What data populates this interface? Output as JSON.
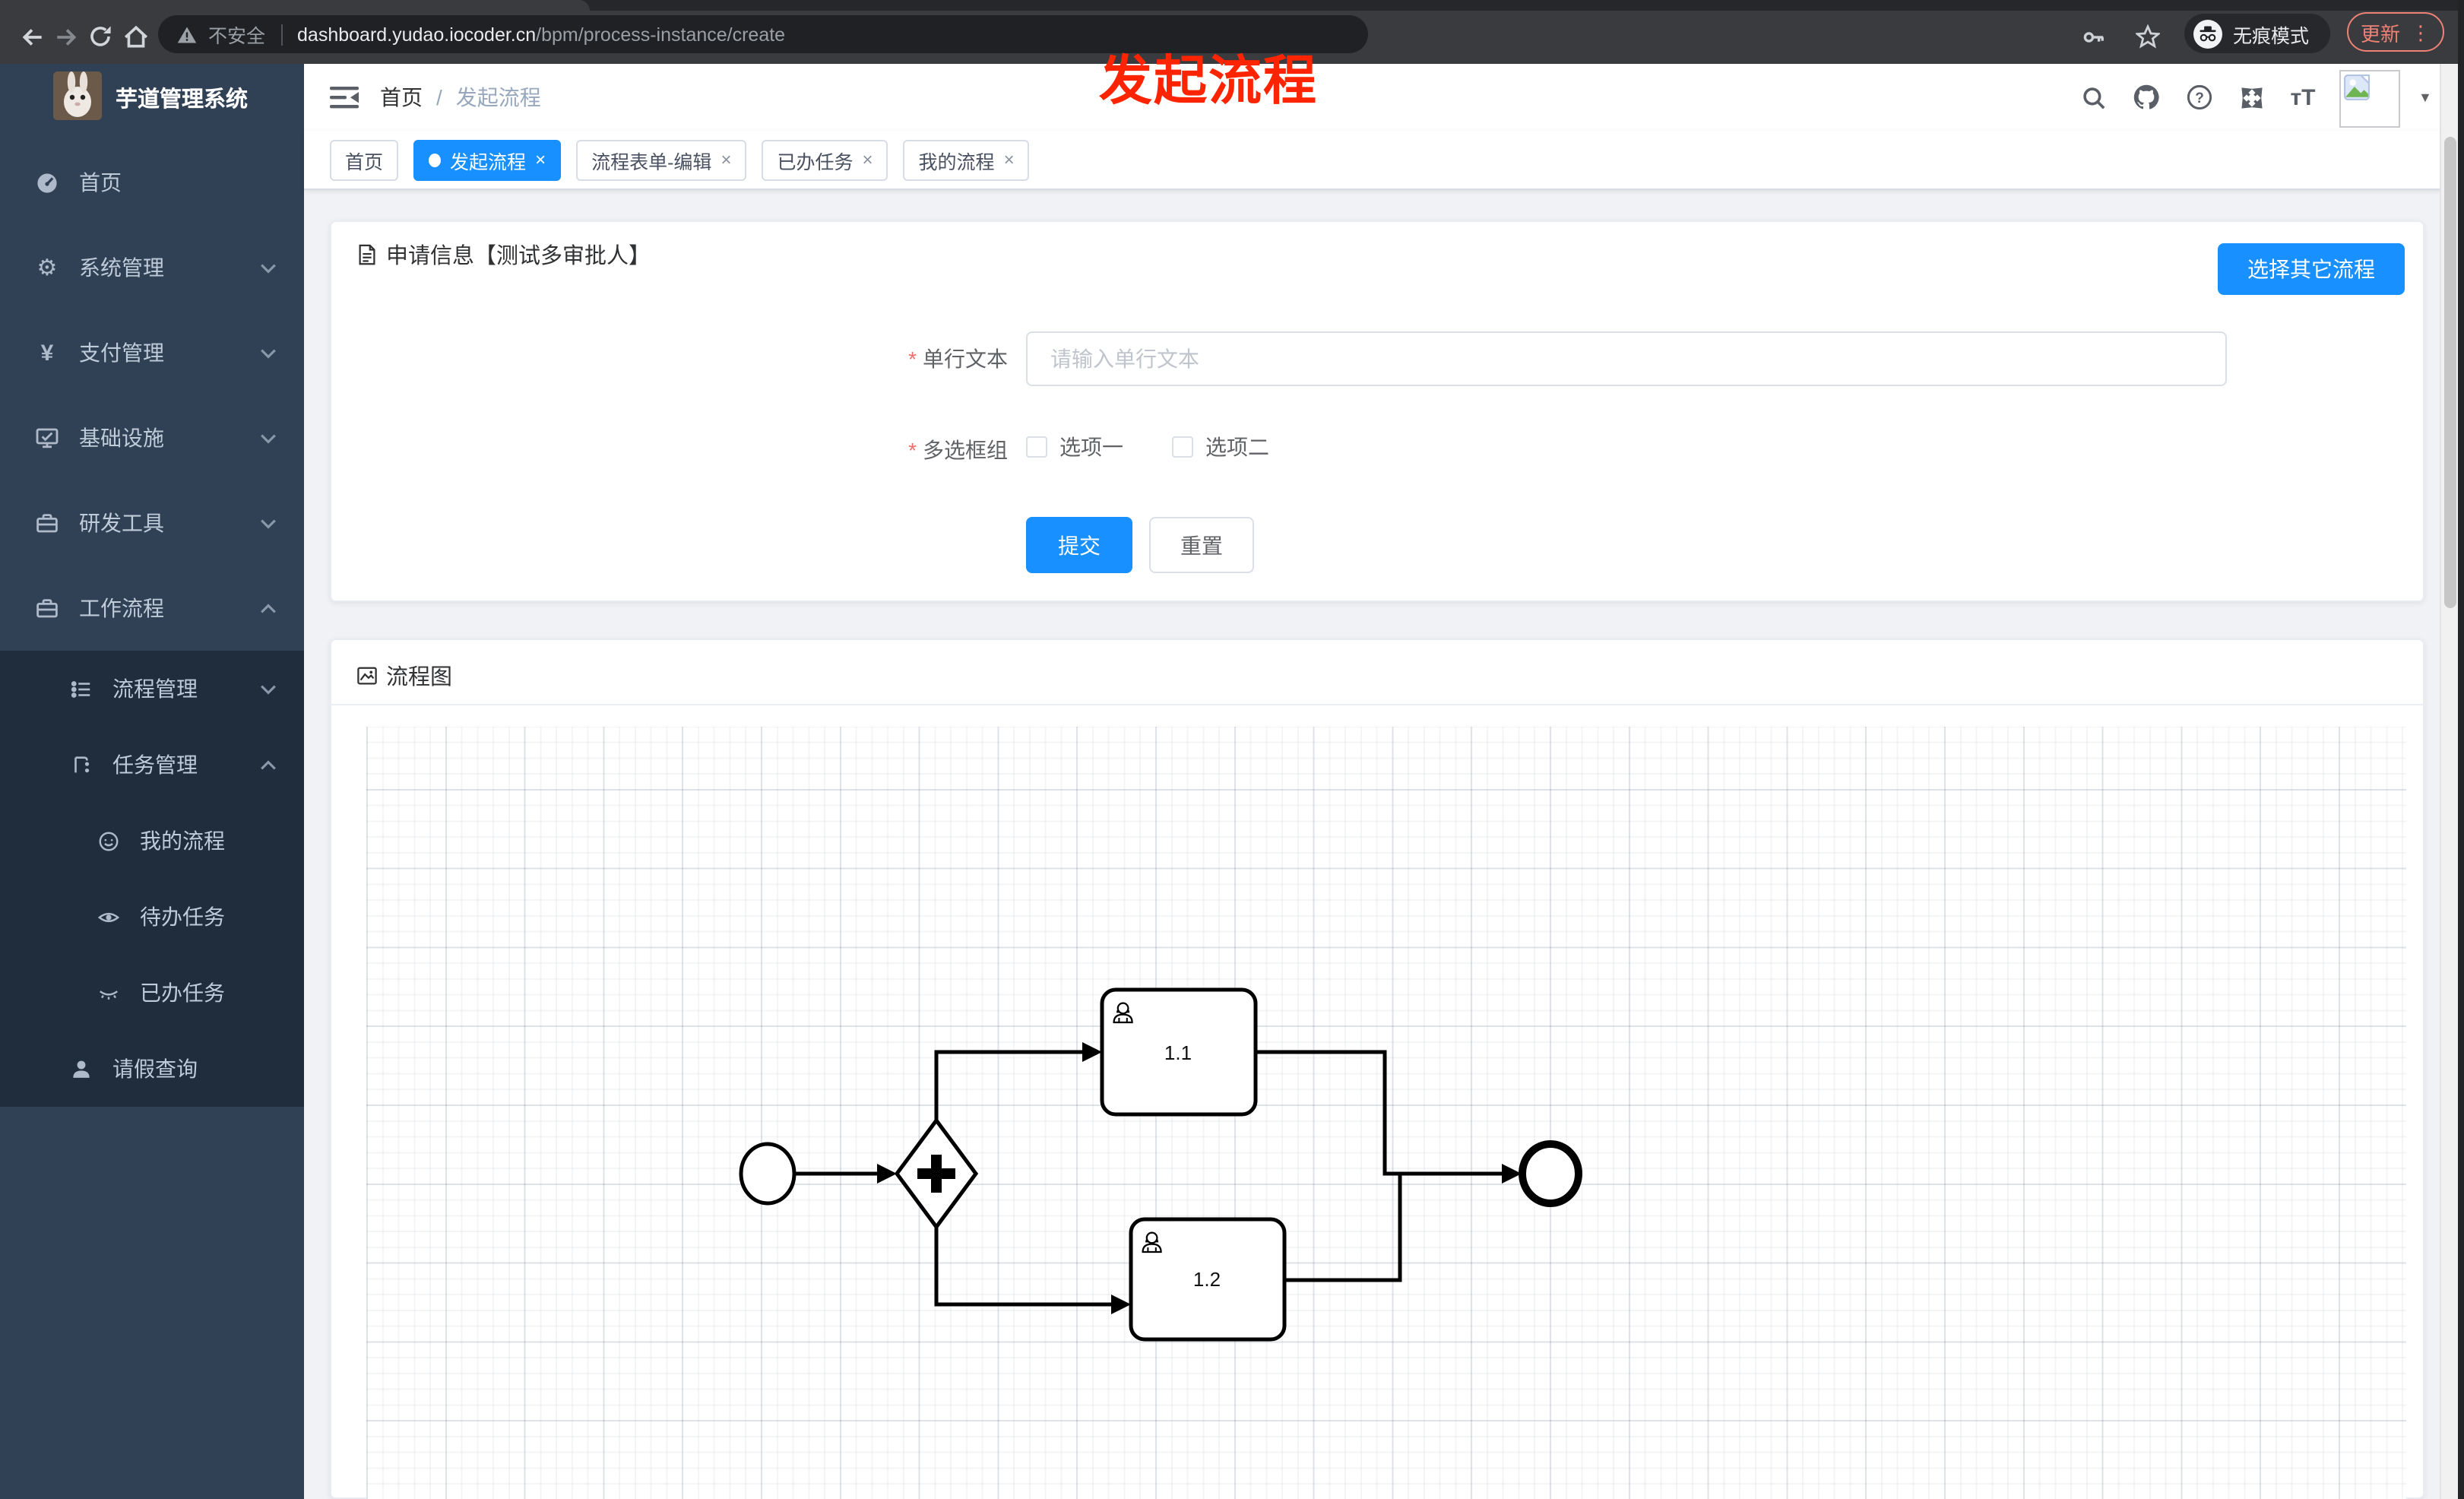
{
  "browser": {
    "security_label": "不安全",
    "url_domain": "dashboard.yudao.iocoder.cn",
    "url_path": "/bpm/process-instance/create",
    "incognito_label": "无痕模式",
    "update_label": "更新"
  },
  "overlay": {
    "title": "发起流程"
  },
  "sidebar": {
    "app_title": "芋道管理系统",
    "items": [
      {
        "label": "首页"
      },
      {
        "label": "系统管理"
      },
      {
        "label": "支付管理"
      },
      {
        "label": "基础设施"
      },
      {
        "label": "研发工具"
      },
      {
        "label": "工作流程"
      },
      {
        "label": "流程管理"
      },
      {
        "label": "任务管理"
      },
      {
        "label": "我的流程"
      },
      {
        "label": "待办任务"
      },
      {
        "label": "已办任务"
      },
      {
        "label": "请假查询"
      }
    ]
  },
  "breadcrumb": {
    "home": "首页",
    "separator": "/",
    "current": "发起流程"
  },
  "tabs": [
    {
      "label": "首页"
    },
    {
      "label": "发起流程"
    },
    {
      "label": "流程表单-编辑"
    },
    {
      "label": "已办任务"
    },
    {
      "label": "我的流程"
    }
  ],
  "form_card": {
    "title": "申请信息【测试多审批人】",
    "choose_button": "选择其它流程",
    "text_field": {
      "label": "单行文本",
      "placeholder": "请输入单行文本"
    },
    "checkbox_group": {
      "label": "多选框组",
      "option1": "选项一",
      "option2": "选项二"
    },
    "submit_label": "提交",
    "reset_label": "重置"
  },
  "diagram_card": {
    "title": "流程图",
    "task1_label": "1.1",
    "task2_label": "1.2"
  },
  "icons": {
    "close": "×",
    "dots": "⋮",
    "caret": "▼",
    "font_size_glyph": "тT",
    "gear": "⚙",
    "yen": "¥"
  },
  "colors": {
    "primary": "#1890ff",
    "sidebar_bg": "#304156",
    "submenu_bg": "#1f2d3d",
    "update_accent": "#ee8277",
    "overlay_red": "#ff2400"
  }
}
